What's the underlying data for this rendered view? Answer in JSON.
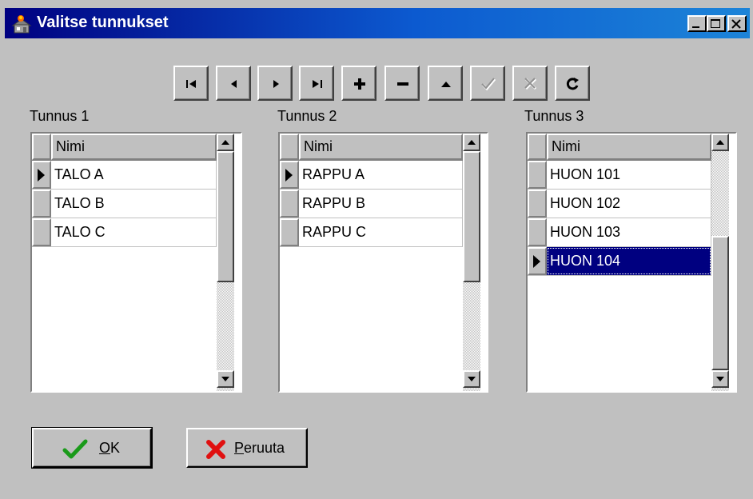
{
  "window": {
    "title": "Valitse tunnukset",
    "controls": [
      "minimize",
      "maximize",
      "close"
    ]
  },
  "navigator": {
    "buttons": [
      {
        "name": "first",
        "icon": "first-record-icon",
        "enabled": true
      },
      {
        "name": "prior",
        "icon": "prior-record-icon",
        "enabled": true
      },
      {
        "name": "next",
        "icon": "next-record-icon",
        "enabled": true
      },
      {
        "name": "last",
        "icon": "last-record-icon",
        "enabled": true
      },
      {
        "name": "insert",
        "icon": "plus-icon",
        "enabled": true
      },
      {
        "name": "delete",
        "icon": "minus-icon",
        "enabled": true
      },
      {
        "name": "edit",
        "icon": "triangle-up-icon",
        "enabled": true
      },
      {
        "name": "post",
        "icon": "checkmark-icon",
        "enabled": false
      },
      {
        "name": "cancel",
        "icon": "x-icon",
        "enabled": false
      },
      {
        "name": "refresh",
        "icon": "refresh-icon",
        "enabled": true
      }
    ]
  },
  "grids": [
    {
      "label": "Tunnus 1",
      "column": "Nimi",
      "rows": [
        "TALO A",
        "TALO B",
        "TALO C"
      ],
      "current": 0,
      "selected": -1
    },
    {
      "label": "Tunnus 2",
      "column": "Nimi",
      "rows": [
        "RAPPU A",
        "RAPPU B",
        "RAPPU C"
      ],
      "current": 0,
      "selected": -1
    },
    {
      "label": "Tunnus 3",
      "column": "Nimi",
      "rows": [
        "HUON 101",
        "HUON 102",
        "HUON 103",
        "HUON 104"
      ],
      "current": 3,
      "selected": 3
    }
  ],
  "buttons": {
    "ok": {
      "mnemonic": "O",
      "rest": "K"
    },
    "cancel": {
      "mnemonic": "P",
      "rest": "eruuta"
    }
  },
  "colors": {
    "selection": "#000080",
    "ok_check": "#1a9a1a",
    "cancel_x": "#e01010"
  }
}
